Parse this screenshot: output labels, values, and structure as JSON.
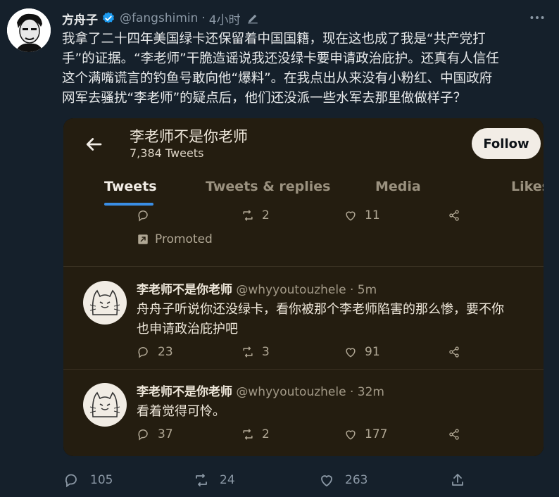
{
  "tweet": {
    "author_name": "方舟子",
    "handle": "@fangshimin",
    "separator": "·",
    "time": "4小时",
    "lines": [
      "我拿了二十四年美国绿卡还保留着中国国籍，现在这也成了我是“共产党打",
      "手”的证据。“李老师”干脆造谣说我还没绿卡要申请政治庇护。还真有人信任",
      "这个满嘴谎言的钓鱼号敢向他“爆料”。在我点出从来没有小粉红、中国政府",
      "网军去骚扰“李老师”的疑点后，他们还没派一些水军去那里做做样子？"
    ],
    "stats": {
      "replies": "105",
      "retweets": "24",
      "likes": "263"
    }
  },
  "embed": {
    "profile_name": "李老师不是你老师",
    "tweet_count": "7,384 Tweets",
    "follow_label": "Follow",
    "tabs": [
      {
        "label": "Tweets"
      },
      {
        "label": "Tweets & replies"
      },
      {
        "label": "Media"
      },
      {
        "label": "Likes"
      }
    ],
    "top_item": {
      "retweets": "2",
      "likes": "11",
      "promoted_label": "Promoted"
    },
    "items": [
      {
        "name": "李老师不是你老师",
        "handle": "@whyyoutouzhele",
        "separator": "·",
        "time": "5m",
        "lines": [
          "舟舟子听说你还没绿卡，看你被那个李老师陷害的那么惨，要不你",
          "也申请政治庇护吧"
        ],
        "replies": "23",
        "retweets": "3",
        "likes": "91"
      },
      {
        "name": "李老师不是你老师",
        "handle": "@whyyoutouzhele",
        "separator": "·",
        "time": "32m",
        "lines": [
          "看着觉得可怜。"
        ],
        "replies": "37",
        "retweets": "2",
        "likes": "177"
      }
    ]
  },
  "colors": {
    "background": "#15202b",
    "verified": "#1d9bf0",
    "embed_background": "#241d10",
    "tab_indicator": "#3a8ee6"
  },
  "icons": [
    "verified-badge-icon",
    "edit-icon",
    "more-icon",
    "back-arrow-icon",
    "reply-icon",
    "retweet-icon",
    "like-icon",
    "share-icon",
    "promoted-icon"
  ]
}
